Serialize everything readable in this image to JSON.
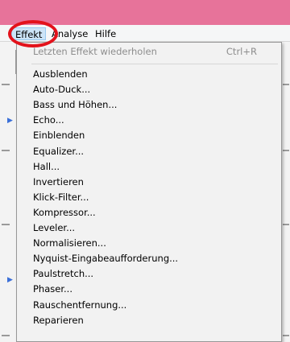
{
  "menubar": {
    "items": [
      "Effekt",
      "Analyse",
      "Hilfe"
    ],
    "active": "Effekt"
  },
  "dropdown": {
    "repeat_last": {
      "label": "Letzten Effekt wiederholen",
      "shortcut": "Ctrl+R"
    },
    "items": [
      "Ausblenden",
      "Auto-Duck...",
      "Bass und Höhen...",
      "Echo...",
      "Einblenden",
      "Equalizer...",
      "Hall...",
      "Invertieren",
      "Klick-Filter...",
      "Kompressor...",
      "Leveler...",
      "Normalisieren...",
      "Nyquist-Eingabeaufforderung...",
      "Paulstretch...",
      "Phaser...",
      "Rauschentfernung...",
      "Reparieren"
    ]
  },
  "colors": {
    "titlebar": "#e7739a",
    "highlight_ring": "#e3121b",
    "menu_active_bg": "#cce4f7"
  }
}
